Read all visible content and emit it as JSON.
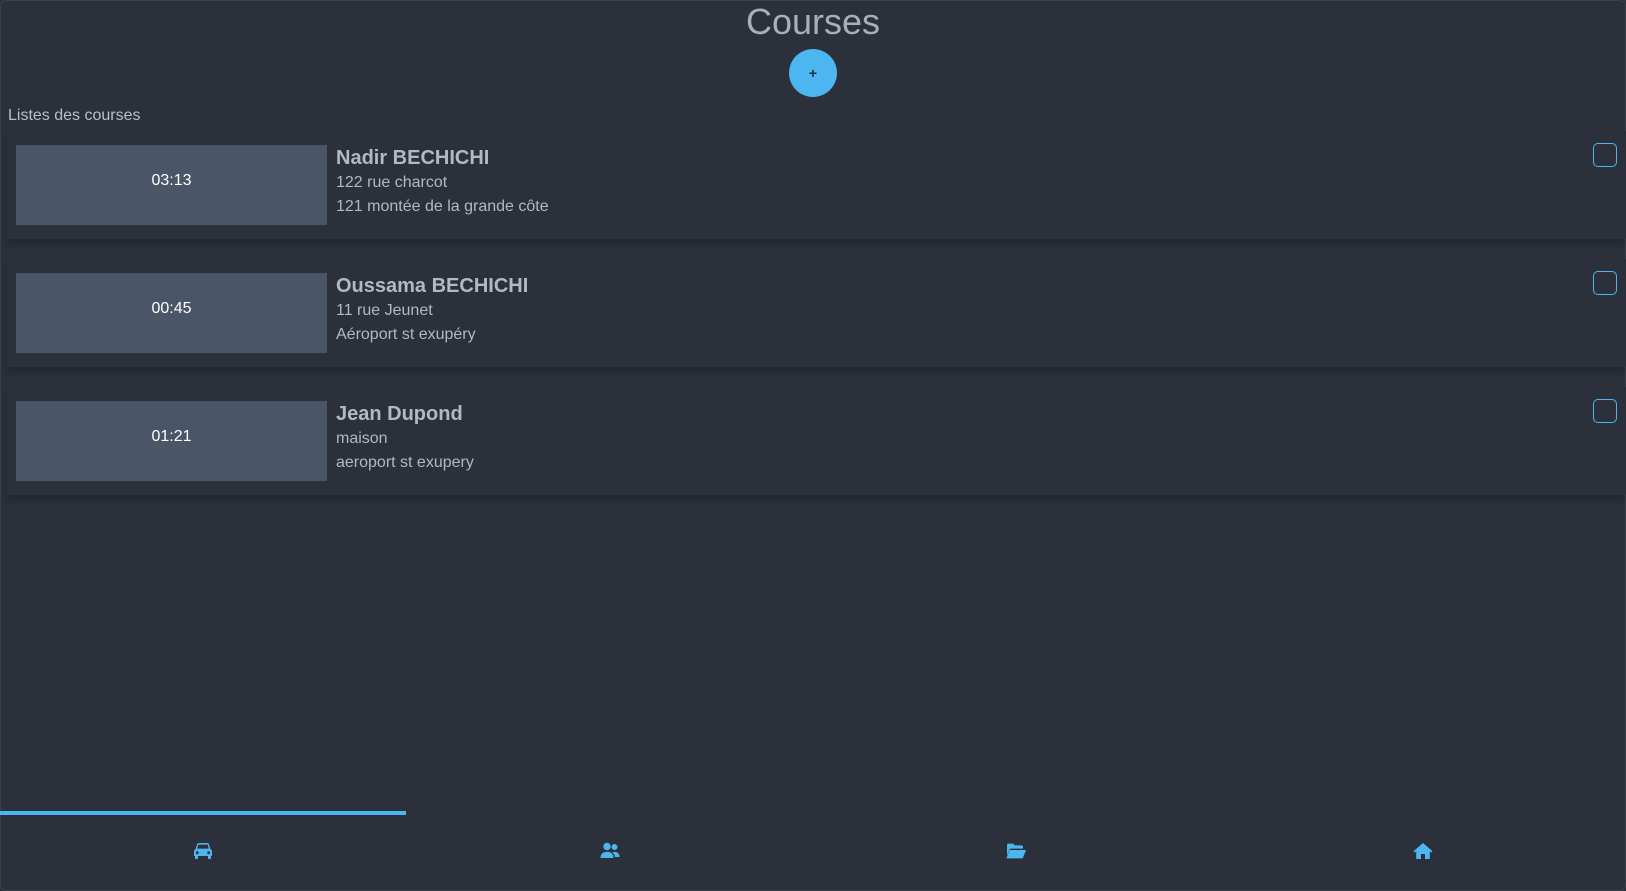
{
  "header": {
    "title": "Courses",
    "add_label": "+"
  },
  "list": {
    "label": "Listes des courses",
    "items": [
      {
        "time": "03:13",
        "name": "Nadir BECHICHI",
        "from": "122 rue charcot",
        "to": "121 montée de la grande côte",
        "checked": false
      },
      {
        "time": "00:45",
        "name": "Oussama BECHICHI",
        "from": "11 rue Jeunet",
        "to": "Aéroport st exupéry",
        "checked": false
      },
      {
        "time": "01:21",
        "name": "Jean Dupond",
        "from": "maison",
        "to": "aeroport st exupery",
        "checked": false
      }
    ]
  },
  "nav": {
    "active_index": 0,
    "tabs": [
      {
        "icon": "car-icon"
      },
      {
        "icon": "users-icon"
      },
      {
        "icon": "folder-open-icon"
      },
      {
        "icon": "home-icon"
      }
    ]
  },
  "colors": {
    "background": "#2b303b",
    "accent": "#4db6f0",
    "time_box": "#4a5567",
    "text": "#b3b8c2"
  }
}
